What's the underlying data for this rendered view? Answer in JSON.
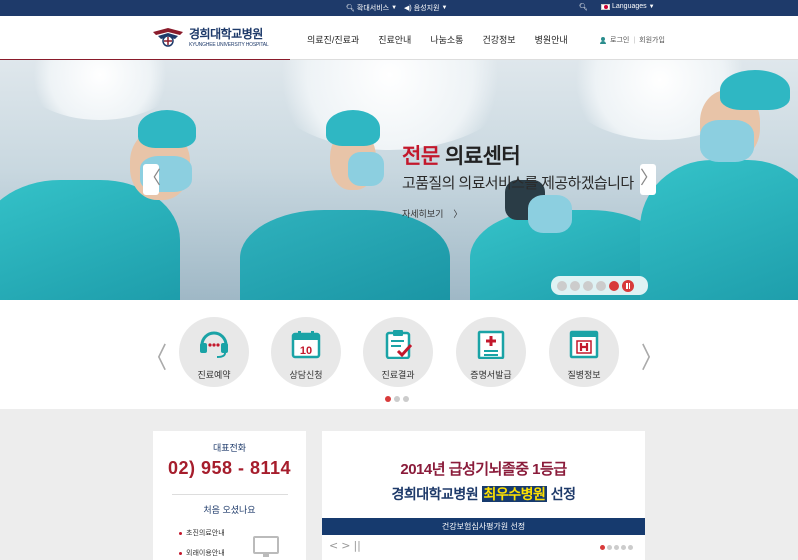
{
  "topbar": {
    "zoom_label": "확대서비스",
    "voice_label": "음성지원",
    "languages_label": "Languages"
  },
  "header": {
    "logo_ko": "경희대학교병원",
    "logo_en": "KYUNGHEE UNIVERSITY HOSPITAL",
    "nav": [
      "의료진/진료과",
      "진료안내",
      "나눔소통",
      "건강정보",
      "병원안내"
    ],
    "login_label": "로그인",
    "signup_label": "회원가입"
  },
  "hero": {
    "title_accent": "전문",
    "title_rest": " 의료센터",
    "subtitle": "고품질의 의료서비스를 제공하겠습니다",
    "more_label": "자세히보기",
    "more_arrow": "〉",
    "prev_arrow": "〈",
    "next_arrow": "〉",
    "slide_count": 5,
    "active_slide": 5
  },
  "quick_menu": {
    "prev_arrow": "〈",
    "next_arrow": "〉",
    "items": [
      {
        "label": "진료예약",
        "icon": "headset-icon"
      },
      {
        "label": "상담신청",
        "icon": "calendar-icon"
      },
      {
        "label": "진료결과",
        "icon": "clipboard-check-icon"
      },
      {
        "label": "증명서발급",
        "icon": "medical-document-icon"
      },
      {
        "label": "질병정보",
        "icon": "hospital-sign-icon"
      }
    ],
    "page_count": 3,
    "active_page": 1
  },
  "contact": {
    "phone_label": "대표전화",
    "phone_number": "02) 958 - 8114",
    "first_visit_label": "처음 오셨나요",
    "links": [
      "초진의료안내",
      "외래이용안내"
    ]
  },
  "banner": {
    "line1": "2014년 급성기뇌졸중 1등급",
    "line2_before": "경희대학교병원 ",
    "line2_highlight": "최우수병원",
    "line2_after": " 선정",
    "strip": "건강보험심사평가원 선정",
    "controls": [
      "<",
      ">",
      "||"
    ],
    "dot_count": 5,
    "active_dot": 1
  },
  "colors": {
    "navy": "#1e3a6a",
    "teal": "#1aa3a6",
    "red": "#c3182c"
  }
}
